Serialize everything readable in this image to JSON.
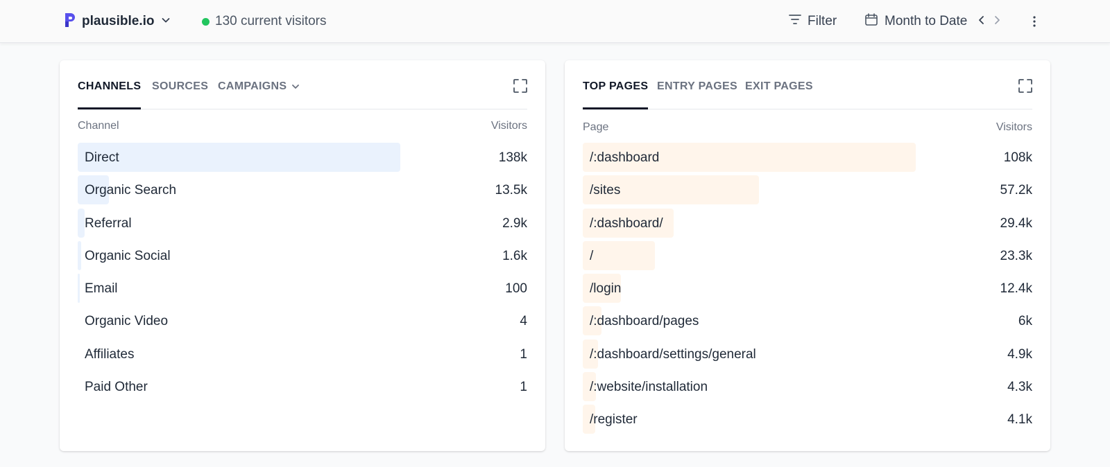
{
  "header": {
    "site_name": "plausible.io",
    "current_visitors": "130 current visitors",
    "filter_label": "Filter",
    "period_label": "Month to Date",
    "accent_color": "#5850ec",
    "live_color": "#22c55e"
  },
  "channels_panel": {
    "tabs": [
      "CHANNELS",
      "SOURCES",
      "CAMPAIGNS"
    ],
    "active_tab": "CHANNELS",
    "column_label": "Channel",
    "metric_label": "Visitors",
    "bar_color": "#eaf2fd",
    "rows": [
      {
        "label": "Direct",
        "value": "138k",
        "share": 0.717
      },
      {
        "label": "Organic Search",
        "value": "13.5k",
        "share": 0.07
      },
      {
        "label": "Referral",
        "value": "2.9k",
        "share": 0.015
      },
      {
        "label": "Organic Social",
        "value": "1.6k",
        "share": 0.008
      },
      {
        "label": "Email",
        "value": "100",
        "share": 0.0005
      },
      {
        "label": "Organic Video",
        "value": "4",
        "share": 0
      },
      {
        "label": "Affiliates",
        "value": "1",
        "share": 0
      },
      {
        "label": "Paid Other",
        "value": "1",
        "share": 0
      }
    ]
  },
  "pages_panel": {
    "tabs": [
      "TOP PAGES",
      "ENTRY PAGES",
      "EXIT PAGES"
    ],
    "active_tab": "TOP PAGES",
    "column_label": "Page",
    "metric_label": "Visitors",
    "bar_color": "#fff5eb",
    "rows": [
      {
        "label": "/:dashboard",
        "value": "108k",
        "share": 0.741
      },
      {
        "label": "/sites",
        "value": "57.2k",
        "share": 0.392
      },
      {
        "label": "/:dashboard/",
        "value": "29.4k",
        "share": 0.202
      },
      {
        "label": "/",
        "value": "23.3k",
        "share": 0.16
      },
      {
        "label": "/login",
        "value": "12.4k",
        "share": 0.085
      },
      {
        "label": "/:dashboard/pages",
        "value": "6k",
        "share": 0.041
      },
      {
        "label": "/:dashboard/settings/general",
        "value": "4.9k",
        "share": 0.034
      },
      {
        "label": "/:website/installation",
        "value": "4.3k",
        "share": 0.03
      },
      {
        "label": "/register",
        "value": "4.1k",
        "share": 0.028
      }
    ]
  }
}
